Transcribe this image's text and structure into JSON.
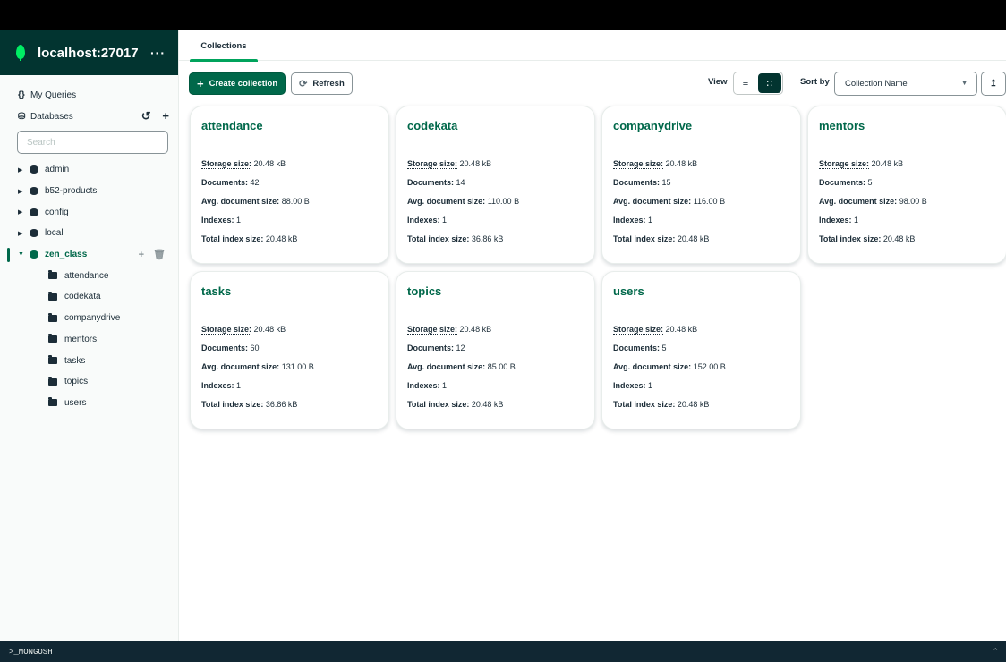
{
  "connection": {
    "name": "localhost:27017",
    "menu": "···"
  },
  "sidebar": {
    "my_queries": "My Queries",
    "databases_label": "Databases",
    "search_placeholder": "Search",
    "databases": [
      {
        "name": "admin",
        "active": false
      },
      {
        "name": "b52-products",
        "active": false
      },
      {
        "name": "config",
        "active": false
      },
      {
        "name": "local",
        "active": false
      },
      {
        "name": "zen_class",
        "active": true
      }
    ],
    "collections": [
      "attendance",
      "codekata",
      "companydrive",
      "mentors",
      "tasks",
      "topics",
      "users"
    ]
  },
  "tabs": [
    {
      "label": "Collections"
    }
  ],
  "toolbar": {
    "create_label": "Create collection",
    "refresh_label": "Refresh",
    "view_label": "View",
    "sort_label": "Sort by",
    "sort_value": "Collection Name"
  },
  "stat_labels": {
    "storage": "Storage size:",
    "documents": "Documents:",
    "avg": "Avg. document size:",
    "indexes": "Indexes:",
    "total_index": "Total index size:"
  },
  "cards": [
    {
      "name": "attendance",
      "storage": "20.48 kB",
      "documents": "42",
      "avg": "88.00 B",
      "indexes": "1",
      "total_index": "20.48 kB"
    },
    {
      "name": "codekata",
      "storage": "20.48 kB",
      "documents": "14",
      "avg": "110.00 B",
      "indexes": "1",
      "total_index": "36.86 kB"
    },
    {
      "name": "companydrive",
      "storage": "20.48 kB",
      "documents": "15",
      "avg": "116.00 B",
      "indexes": "1",
      "total_index": "20.48 kB"
    },
    {
      "name": "mentors",
      "storage": "20.48 kB",
      "documents": "5",
      "avg": "98.00 B",
      "indexes": "1",
      "total_index": "20.48 kB"
    },
    {
      "name": "tasks",
      "storage": "20.48 kB",
      "documents": "60",
      "avg": "131.00 B",
      "indexes": "1",
      "total_index": "36.86 kB"
    },
    {
      "name": "topics",
      "storage": "20.48 kB",
      "documents": "12",
      "avg": "85.00 B",
      "indexes": "1",
      "total_index": "20.48 kB"
    },
    {
      "name": "users",
      "storage": "20.48 kB",
      "documents": "5",
      "avg": "152.00 B",
      "indexes": "1",
      "total_index": "20.48 kB"
    }
  ],
  "shell": {
    "label": ">_MONGOSH"
  },
  "colors": {
    "accent": "#00684a",
    "brand_dark": "#023430",
    "leaf": "#00ed64"
  }
}
